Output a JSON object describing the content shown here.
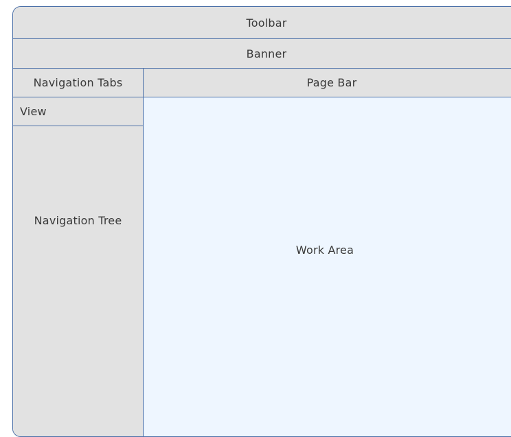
{
  "regions": {
    "toolbar": "Toolbar",
    "banner": "Banner",
    "navigation_tabs": "Navigation Tabs",
    "page_bar": "Page Bar",
    "view": "View",
    "navigation_tree": "Navigation Tree",
    "work_area": "Work Area"
  },
  "colors": {
    "border": "#4a6fa8",
    "panel": "#e2e2e2",
    "work_area": "#eef6ff"
  }
}
